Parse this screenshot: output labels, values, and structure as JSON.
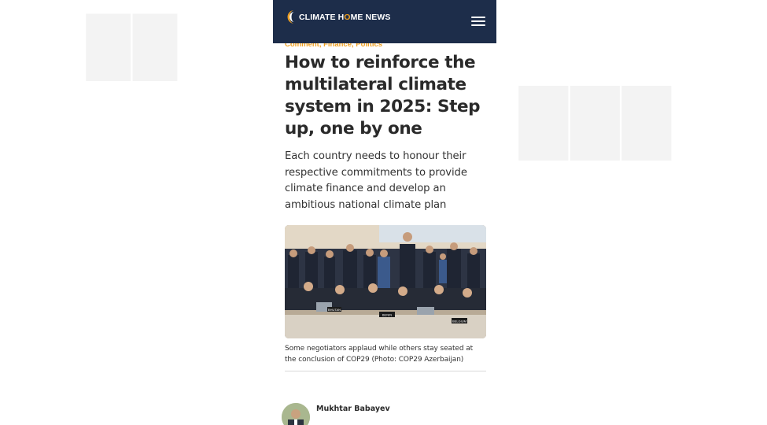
{
  "site": {
    "logo_text_before": "CLIMATE H",
    "logo_text_o": "O",
    "logo_text_after": "ME NEWS",
    "colors": {
      "header_bg": "#1d2d4a",
      "accent": "#f0a020",
      "text": "#2a2a2a"
    },
    "icons": {
      "logo": "sun-logo-icon",
      "menu": "hamburger-menu-icon"
    }
  },
  "article": {
    "categories": [
      "Comment",
      "Finance",
      "Politics"
    ],
    "category_separator": ", ",
    "headline": "How to reinforce the multilateral climate system in 2025: Step up, one by one",
    "standfirst": "Each country needs to honour their respective commitments to provide climate finance and develop an ambitious national climate plan",
    "photo": {
      "caption": "Some negotiators applaud while others stay seated at the conclusion of COP29 (Photo: COP29 Azerbaijan)",
      "placards": [
        "BENIN",
        "BELGIUM",
        "BHUTAN"
      ]
    },
    "author": {
      "name": "Mukhtar Babayev"
    }
  }
}
